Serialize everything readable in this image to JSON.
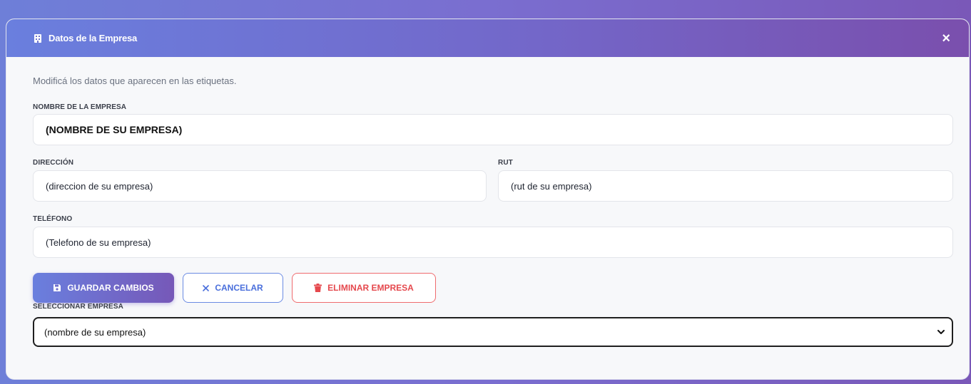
{
  "modal": {
    "title": "Datos de la Empresa",
    "close_label": "×",
    "intro": "Modificá los datos que aparecen en las etiquetas."
  },
  "fields": {
    "nombre": {
      "label": "NOMBRE DE LA EMPRESA",
      "value": "(NOMBRE DE SU EMPRESA)"
    },
    "direccion": {
      "label": "DIRECCIÓN",
      "value": "(direccion de su empresa)"
    },
    "rut": {
      "label": "RUT",
      "value": "(rut de su empresa)"
    },
    "telefono": {
      "label": "TELÉFONO",
      "value": "(Telefono de su empresa)"
    }
  },
  "buttons": {
    "save": "GUARDAR CAMBIOS",
    "cancel": "CANCELAR",
    "delete": "ELIMINAR EMPRESA"
  },
  "selector": {
    "label": "SELECCIONAR EMPRESA",
    "selected": "(nombre de su empresa)"
  },
  "icons": {
    "header": "building-icon",
    "save": "floppy-disk-icon",
    "cancel": "x-icon",
    "delete": "trash-icon",
    "select": "chevron-down-icon"
  },
  "colors": {
    "accent": "#6a7fde",
    "accent_end": "#7658b8",
    "cancel": "#4a6fdc",
    "danger": "#e5484d"
  }
}
